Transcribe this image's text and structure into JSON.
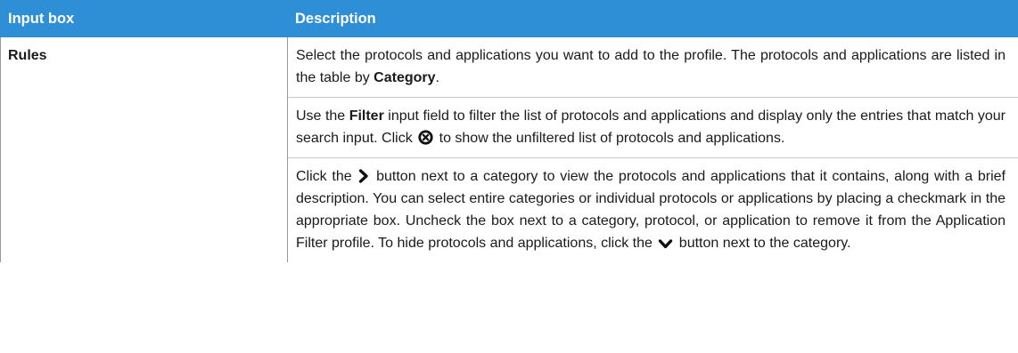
{
  "table": {
    "headers": {
      "input_box": "Input box",
      "description": "Description"
    },
    "row": {
      "name": "Rules",
      "para1": {
        "text1": "Select the protocols and applications you want to add to the profile. The protocols and applications are listed in the table by ",
        "bold1": "Category",
        "text2": "."
      },
      "para2": {
        "text1": "Use the ",
        "bold1": "Filter",
        "text2": " input field to filter the list of protocols and applications and display only the entries that match your search input. Click ",
        "text3": " to show the unfiltered list of protocols and applications."
      },
      "para3": {
        "text1": "Click the ",
        "text2": " button next to a category to view the protocols and applications that it contains, along with a brief description. You can select entire categories or individual protocols or applications by placing a checkmark in the appropriate box. Uncheck the box next to a category, protocol, or application to remove it from the Application Filter profile. To hide protocols and applications, click the ",
        "text3": " button next to the category."
      }
    }
  },
  "icons": {
    "clear_filter": "times-circle-icon",
    "expand": "chevron-right-icon",
    "collapse": "chevron-down-icon"
  },
  "colors": {
    "header_bg": "#2f8fd6",
    "header_text": "#ffffff",
    "border": "#9a9a9a"
  }
}
